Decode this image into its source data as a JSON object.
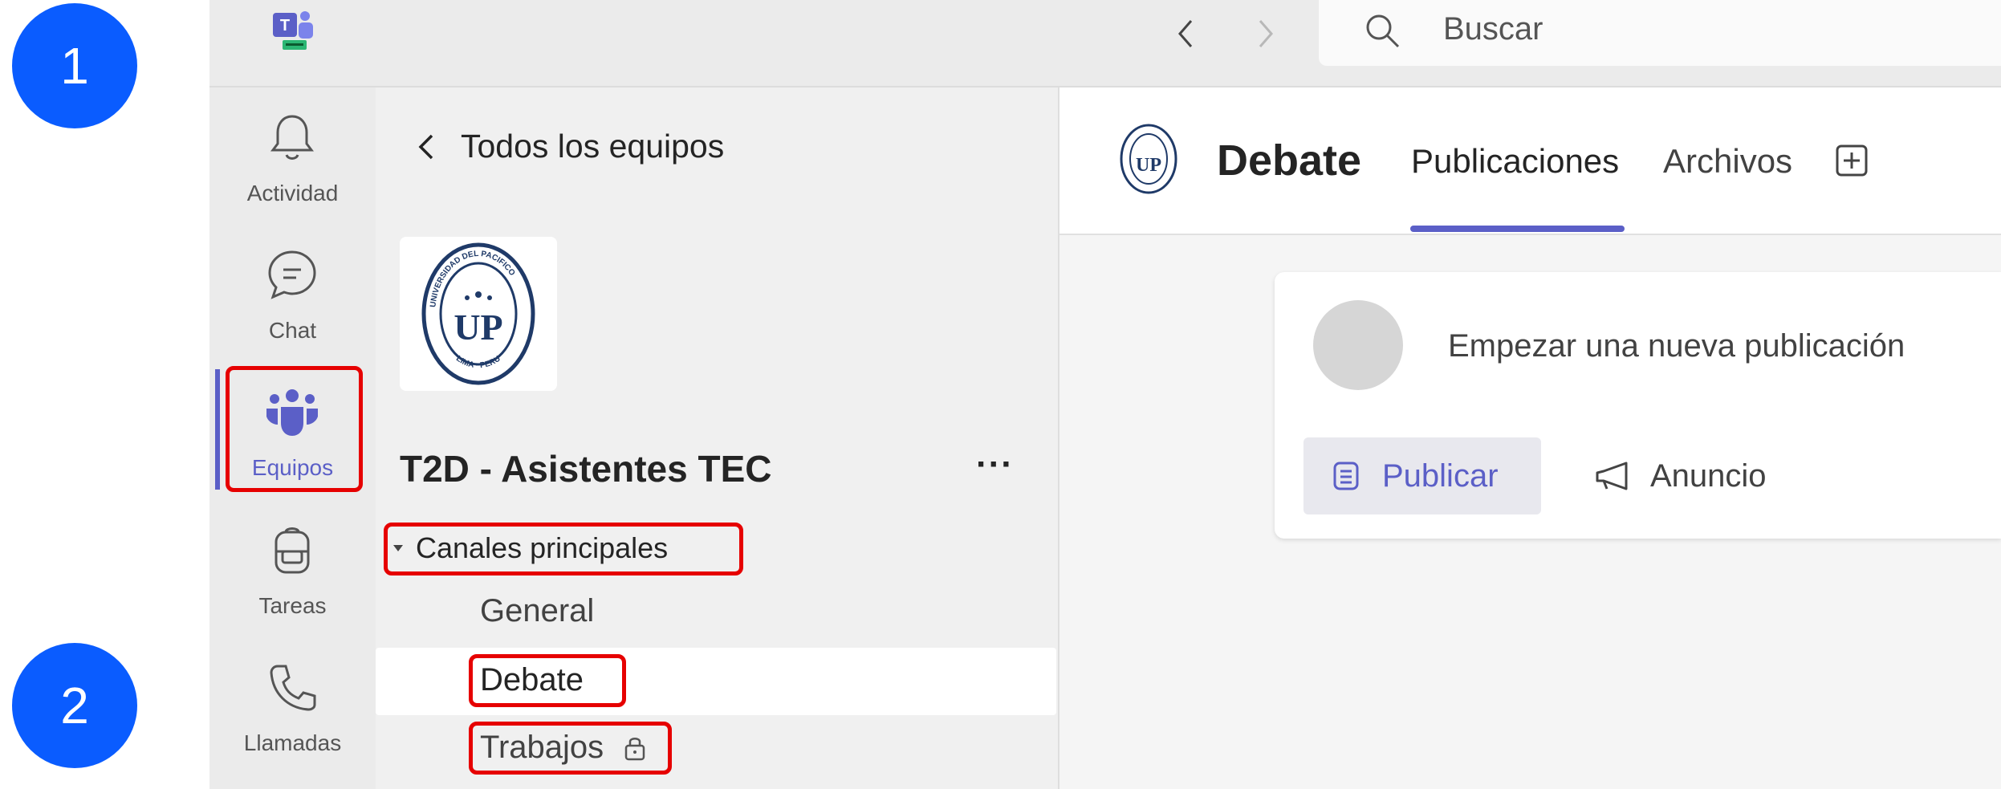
{
  "steps": {
    "one": "1",
    "two": "2"
  },
  "search": {
    "placeholder": "Buscar"
  },
  "rail": {
    "items": [
      {
        "label": "Actividad",
        "icon": "bell-icon"
      },
      {
        "label": "Chat",
        "icon": "chat-icon"
      },
      {
        "label": "Equipos",
        "icon": "teams-icon"
      },
      {
        "label": "Tareas",
        "icon": "backpack-icon"
      },
      {
        "label": "Llamadas",
        "icon": "phone-icon"
      }
    ],
    "active": "Equipos"
  },
  "team_panel": {
    "back_label": "Todos los equipos",
    "team_name": "T2D - Asistentes TEC",
    "more": "···",
    "group_label": "Canales principales",
    "channels": [
      {
        "name": "General"
      },
      {
        "name": "Debate"
      },
      {
        "name": "Trabajos"
      }
    ]
  },
  "logo": {
    "top": "UNIVERSIDAD DEL PACIFICO",
    "bottom": "LIMA · PERU",
    "monogram": "UP"
  },
  "main": {
    "channel_title": "Debate",
    "tabs": [
      {
        "label": "Publicaciones",
        "active": true
      },
      {
        "label": "Archivos",
        "active": false
      }
    ],
    "compose_placeholder": "Empezar una nueva publicación",
    "publish_label": "Publicar",
    "announce_label": "Anuncio"
  },
  "colors": {
    "accent": "#5b5fc7",
    "highlight": "#e60000",
    "badge": "#0a5cff"
  }
}
